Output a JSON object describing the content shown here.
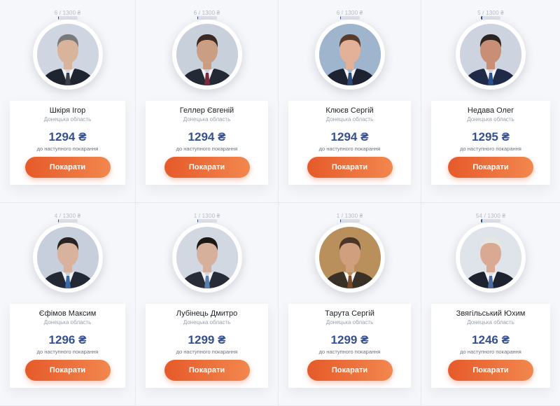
{
  "candidates": [
    {
      "progress": "6 / 1300 ₴",
      "progress_fraction": 0.00462,
      "name": "Шкіря Ігор",
      "region": "Донецька область",
      "price": "1294 ₴",
      "price_caption": "до наступного покарання",
      "button_label": "Покарати",
      "hair": "#7a7a7a",
      "skin": "#d7b49b",
      "suit": "#1f2530",
      "tie": "#3b3f4a",
      "bg": "#cfd6e1"
    },
    {
      "progress": "6 / 1300 ₴",
      "progress_fraction": 0.00462,
      "name": "Геллер Євгеній",
      "region": "Донецька область",
      "price": "1294 ₴",
      "price_caption": "до наступного покарання",
      "button_label": "Покарати",
      "hair": "#3a2a22",
      "skin": "#c99e83",
      "suit": "#242a35",
      "tie": "#7a2a3c",
      "bg": "#c8d0dc"
    },
    {
      "progress": "6 / 1300 ₴",
      "progress_fraction": 0.00462,
      "name": "Клюєв Сергій",
      "region": "Донецька область",
      "price": "1294 ₴",
      "price_caption": "до наступного покарання",
      "button_label": "Покарати",
      "hair": "#5a3a28",
      "skin": "#e3b197",
      "suit": "#1c2230",
      "tie": "#2d4a78",
      "bg": "#9fb4cd"
    },
    {
      "progress": "5 / 1300 ₴",
      "progress_fraction": 0.00385,
      "name": "Недава Олег",
      "region": "Донецька область",
      "price": "1295 ₴",
      "price_caption": "до наступного покарання",
      "button_label": "Покарати",
      "hair": "#2c2420",
      "skin": "#c98e76",
      "suit": "#1e2a48",
      "tie": "#2c4f8e",
      "bg": "#cdd4df"
    },
    {
      "progress": "4 / 1300 ₴",
      "progress_fraction": 0.00308,
      "name": "Єфімов Максим",
      "region": "Донецька область",
      "price": "1296 ₴",
      "price_caption": "до наступного покарання",
      "button_label": "Покарати",
      "hair": "#2a2420",
      "skin": "#d8b29c",
      "suit": "#222834",
      "tie": "#3a6aa8",
      "bg": "#c6cfdb"
    },
    {
      "progress": "1 / 1300 ₴",
      "progress_fraction": 0.00077,
      "name": "Лубінець Дмитро",
      "region": "Донецька область",
      "price": "1299 ₴",
      "price_caption": "до наступного покарання",
      "button_label": "Покарати",
      "hair": "#1c1816",
      "skin": "#d6b09a",
      "suit": "#262c38",
      "tie": "#5a7fb0",
      "bg": "#d2d8e2"
    },
    {
      "progress": "1 / 1300 ₴",
      "progress_fraction": 0.00077,
      "name": "Тарута Сергій",
      "region": "Донецька область",
      "price": "1299 ₴",
      "price_caption": "до наступного покарання",
      "button_label": "Покарати",
      "hair": "#4a3526",
      "skin": "#cf9f7e",
      "suit": "#3a3126",
      "tie": "#7a4a2a",
      "bg": "#b98f5c"
    },
    {
      "progress": "54 / 1300 ₴",
      "progress_fraction": 0.04154,
      "name": "Звягільський Юхим",
      "region": "Донецька область",
      "price": "1246 ₴",
      "price_caption": "до наступного покарання",
      "button_label": "Покарати",
      "hair": "#e8e6e2",
      "skin": "#d9a993",
      "suit": "#1d2230",
      "tie": "#4a6aa0",
      "bg": "#dfe3ea"
    }
  ]
}
